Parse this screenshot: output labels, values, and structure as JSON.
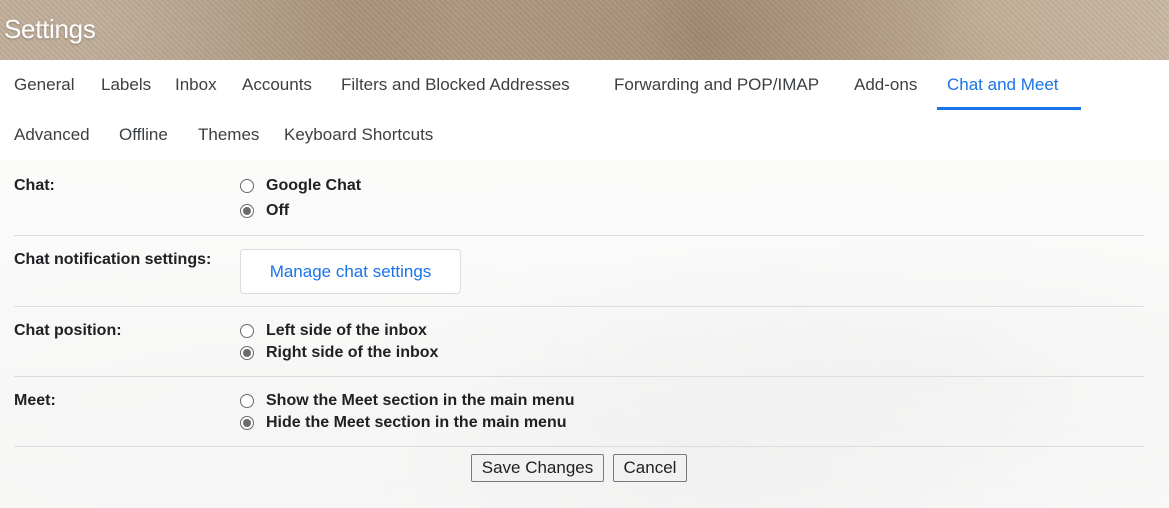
{
  "header": {
    "title": "Settings"
  },
  "tabs": [
    {
      "label": "General",
      "active": false
    },
    {
      "label": "Labels",
      "active": false
    },
    {
      "label": "Inbox",
      "active": false
    },
    {
      "label": "Accounts",
      "active": false
    },
    {
      "label": "Filters and Blocked Addresses",
      "active": false
    },
    {
      "label": "Forwarding and POP/IMAP",
      "active": false
    },
    {
      "label": "Add-ons",
      "active": false
    },
    {
      "label": "Chat and Meet",
      "active": true
    },
    {
      "label": "Advanced",
      "active": false
    },
    {
      "label": "Offline",
      "active": false
    },
    {
      "label": "Themes",
      "active": false
    },
    {
      "label": "Keyboard Shortcuts",
      "active": false
    }
  ],
  "accent_color": "#1a73e8",
  "sections": {
    "chat": {
      "label": "Chat:",
      "options": [
        {
          "label": "Google Chat",
          "checked": false
        },
        {
          "label": "Off",
          "checked": true
        }
      ]
    },
    "notifications": {
      "label": "Chat notification settings:",
      "button_label": "Manage chat settings"
    },
    "position": {
      "label": "Chat position:",
      "options": [
        {
          "label": "Left side of the inbox",
          "checked": false
        },
        {
          "label": "Right side of the inbox",
          "checked": true
        }
      ]
    },
    "meet": {
      "label": "Meet:",
      "options": [
        {
          "label": "Show the Meet section in the main menu",
          "checked": false
        },
        {
          "label": "Hide the Meet section in the main menu",
          "checked": true
        }
      ]
    }
  },
  "actions": {
    "save_label": "Save Changes",
    "cancel_label": "Cancel"
  }
}
